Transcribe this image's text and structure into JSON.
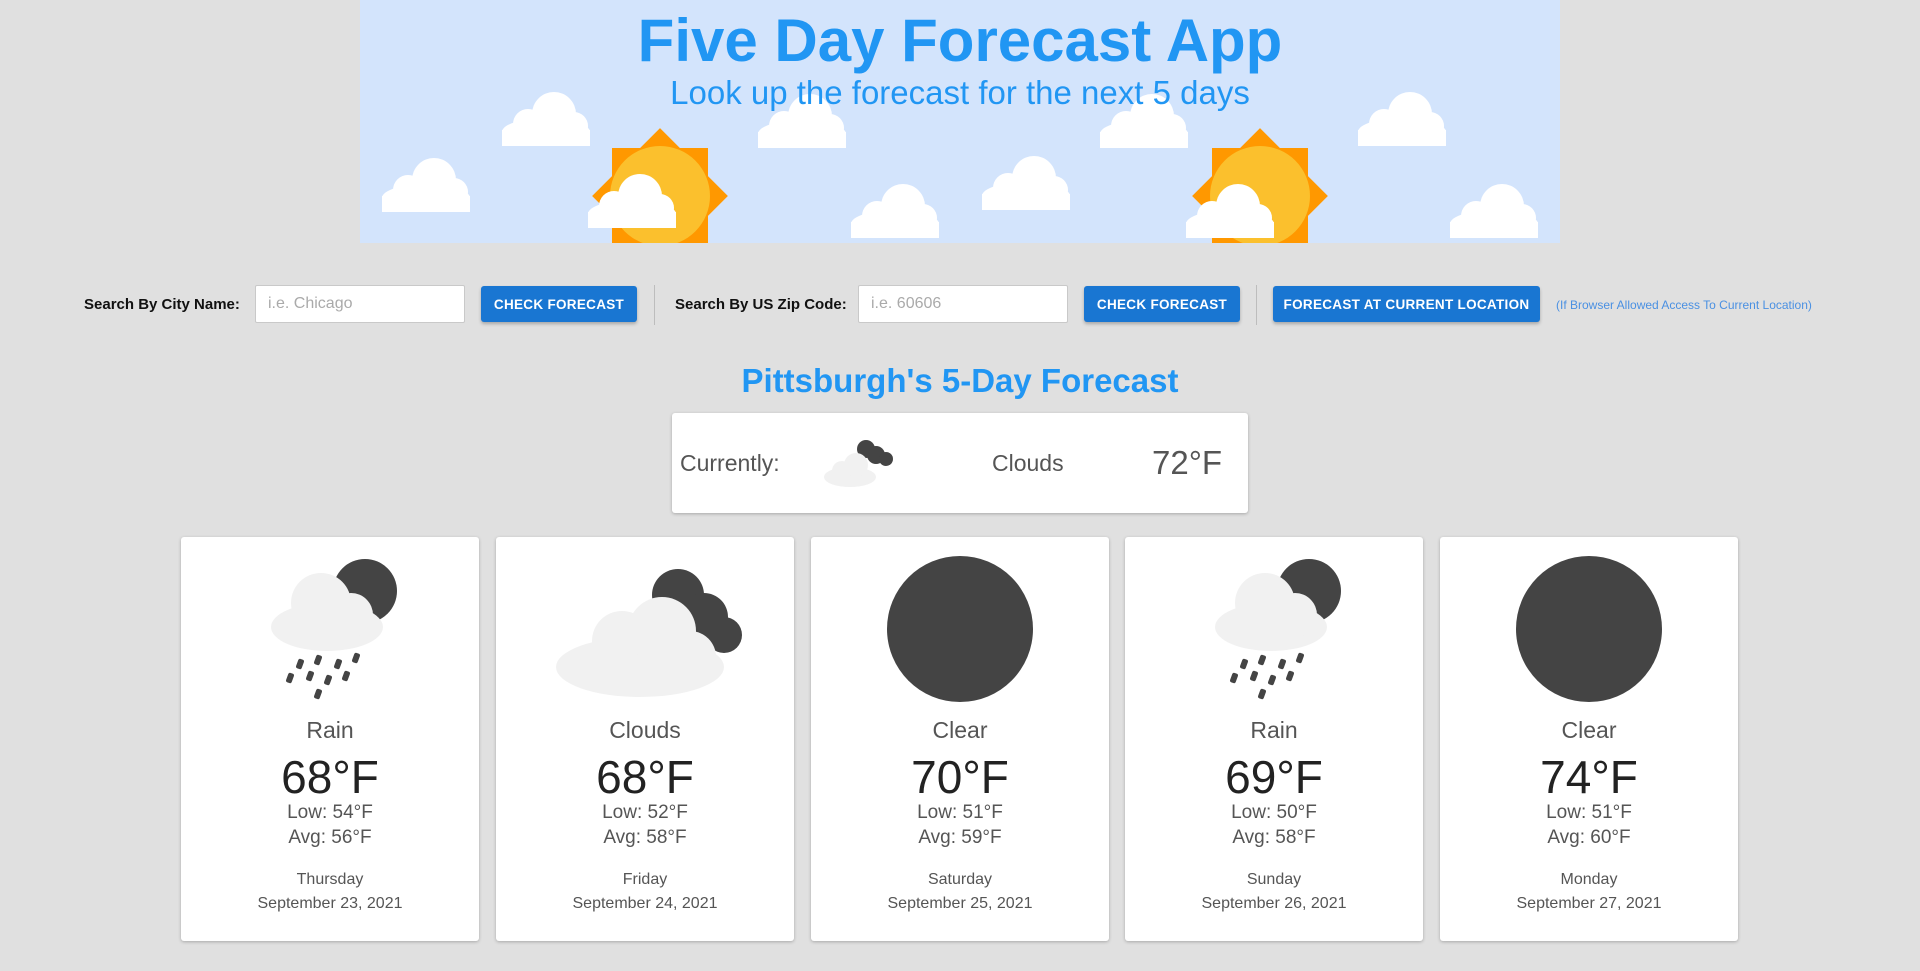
{
  "header": {
    "title": "Five Day Forecast App",
    "subtitle": "Look up the forecast for the next 5 days"
  },
  "search": {
    "city_label": "Search By City Name:",
    "city_placeholder": "i.e. Chicago",
    "city_button": "CHECK FORECAST",
    "zip_label": "Search By US Zip Code:",
    "zip_placeholder": "i.e. 60606",
    "zip_button": "CHECK FORECAST",
    "location_button": "FORECAST AT CURRENT LOCATION",
    "location_note": "(If Browser Allowed Access To Current Location)"
  },
  "forecast": {
    "title": "Pittsburgh's 5-Day Forecast",
    "current": {
      "label": "Currently:",
      "icon": "cloudy-night-icon",
      "condition": "Clouds",
      "temp": "72°F"
    },
    "days": [
      {
        "icon": "rain-night-icon",
        "condition": "Rain",
        "temp": "68°F",
        "low": "Low: 54°F",
        "avg": "Avg: 56°F",
        "weekday": "Thursday",
        "date": "September 23, 2021"
      },
      {
        "icon": "cloudy-night-icon",
        "condition": "Clouds",
        "temp": "68°F",
        "low": "Low: 52°F",
        "avg": "Avg: 58°F",
        "weekday": "Friday",
        "date": "September 24, 2021"
      },
      {
        "icon": "clear-night-icon",
        "condition": "Clear",
        "temp": "70°F",
        "low": "Low: 51°F",
        "avg": "Avg: 59°F",
        "weekday": "Saturday",
        "date": "September 25, 2021"
      },
      {
        "icon": "rain-night-icon",
        "condition": "Rain",
        "temp": "69°F",
        "low": "Low: 50°F",
        "avg": "Avg: 58°F",
        "weekday": "Sunday",
        "date": "September 26, 2021"
      },
      {
        "icon": "clear-night-icon",
        "condition": "Clear",
        "temp": "74°F",
        "low": "Low: 51°F",
        "avg": "Avg: 60°F",
        "weekday": "Monday",
        "date": "September 27, 2021"
      }
    ]
  },
  "colors": {
    "accent": "#2196f3",
    "button": "#1976d2",
    "banner_bg": "#d3e4fc",
    "page_bg": "#e0e0e0"
  }
}
